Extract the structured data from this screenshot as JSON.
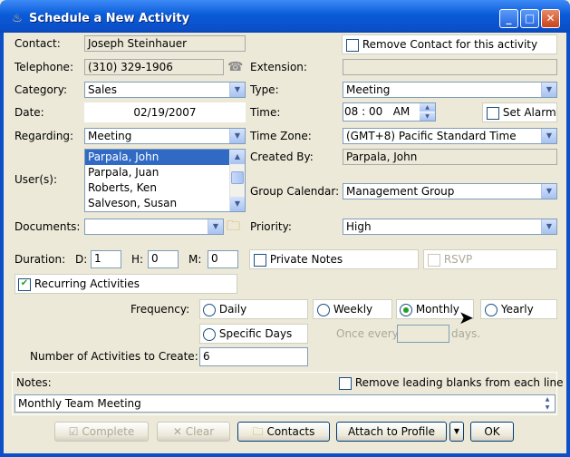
{
  "window": {
    "title": "Schedule a New Activity",
    "minimize": "_",
    "maximize": "□",
    "close": "✕"
  },
  "contact": {
    "label": "Contact:",
    "value": "Joseph Steinhauer",
    "remove_label": "Remove Contact for this activity"
  },
  "telephone": {
    "label": "Telephone:",
    "value": "(310) 329-1906"
  },
  "extension": {
    "label": "Extension:",
    "value": ""
  },
  "category": {
    "label": "Category:",
    "value": "Sales"
  },
  "type": {
    "label": "Type:",
    "value": "Meeting"
  },
  "date": {
    "label": "Date:",
    "value": "02/19/2007"
  },
  "time": {
    "label": "Time:",
    "hour": "08",
    "sep": ":",
    "minute": "00",
    "ampm": "AM",
    "set_alarm_label": "Set Alarm"
  },
  "regarding": {
    "label": "Regarding:",
    "value": "Meeting"
  },
  "timezone": {
    "label": "Time Zone:",
    "value": "(GMT+8) Pacific Standard Time"
  },
  "users": {
    "label": "User(s):",
    "items": [
      "Parpala, John",
      "Parpala, Juan",
      "Roberts, Ken",
      "Salveson, Susan"
    ],
    "selected": "Parpala, John"
  },
  "created_by": {
    "label": "Created By:",
    "value": "Parpala, John"
  },
  "group_calendar": {
    "label": "Group Calendar:",
    "value": "Management Group"
  },
  "documents": {
    "label": "Documents:",
    "value": ""
  },
  "priority": {
    "label": "Priority:",
    "value": "High"
  },
  "duration": {
    "label": "Duration:",
    "d_label": "D:",
    "d_value": "1",
    "h_label": "H:",
    "h_value": "0",
    "m_label": "M:",
    "m_value": "0"
  },
  "private_notes": {
    "label": "Private Notes"
  },
  "rsvp": {
    "label": "RSVP"
  },
  "recurring": {
    "label": "Recurring Activities",
    "checked": true
  },
  "frequency": {
    "label": "Frequency:",
    "options": [
      "Daily",
      "Weekly",
      "Monthly",
      "Yearly"
    ],
    "selected": "Monthly",
    "specific_days": "Specific Days",
    "once_every": "Once every",
    "days": "days."
  },
  "num_activities": {
    "label": "Number of Activities to Create:",
    "value": "6"
  },
  "notes": {
    "label": "Notes:",
    "value": "Monthly Team Meeting",
    "remove_blanks_label": "Remove leading blanks from each line"
  },
  "buttons": {
    "complete": "Complete",
    "clear": "Clear",
    "contacts": "Contacts",
    "attach": "Attach to Profile",
    "ok": "OK"
  }
}
